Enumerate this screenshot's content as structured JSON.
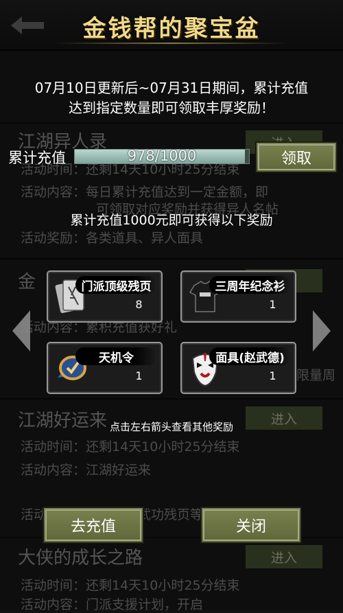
{
  "title": "金钱帮的聚宝盆",
  "description_lines": [
    "07月10日更新后~07月31日期间，累计充值",
    "达到指定数量即可领取丰厚奖励！"
  ],
  "progress": {
    "label": "累计充值",
    "current": 978,
    "target": 1000,
    "text": "978/1000"
  },
  "claim_button": "领取",
  "reward_hint": "累计充值1000元即可获得以下奖励",
  "rewards": [
    {
      "name": "门派顶级残页",
      "count": "8",
      "icon": "scroll-icon"
    },
    {
      "name": "三周年纪念衫",
      "count": "1",
      "icon": "tshirt-icon"
    },
    {
      "name": "天机令",
      "count": "1",
      "icon": "token-icon"
    },
    {
      "name": "面具(赵武德)",
      "count": "1",
      "icon": "opera-mask-icon"
    }
  ],
  "nav_hint": "点击左右箭头查看其他奖励",
  "recharge_button": "去充值",
  "close_button": "关闭",
  "background": {
    "headings": [
      "江湖异人录",
      "金",
      "江湖好运来",
      "大侠的成长之路"
    ],
    "enter_label": "进入",
    "rows": [
      "活动时间：还剩14天10小时25分结束",
      "活动内容：每日累计充值达到一定金额，即",
      "可领取对应奖励并获得异人名帖",
      "活动奖励：各类道具、异人面具",
      "活动内容：累积充值获好礼",
      "限量周",
      "活动时间：还剩14天10小时25分结束",
      "活动内容：江湖好运来",
      "活动奖励：门派页、武功残页等。",
      "活动时间：还剩14天10小时25分结束",
      "活动内容：门派支援计划，开启"
    ]
  }
}
